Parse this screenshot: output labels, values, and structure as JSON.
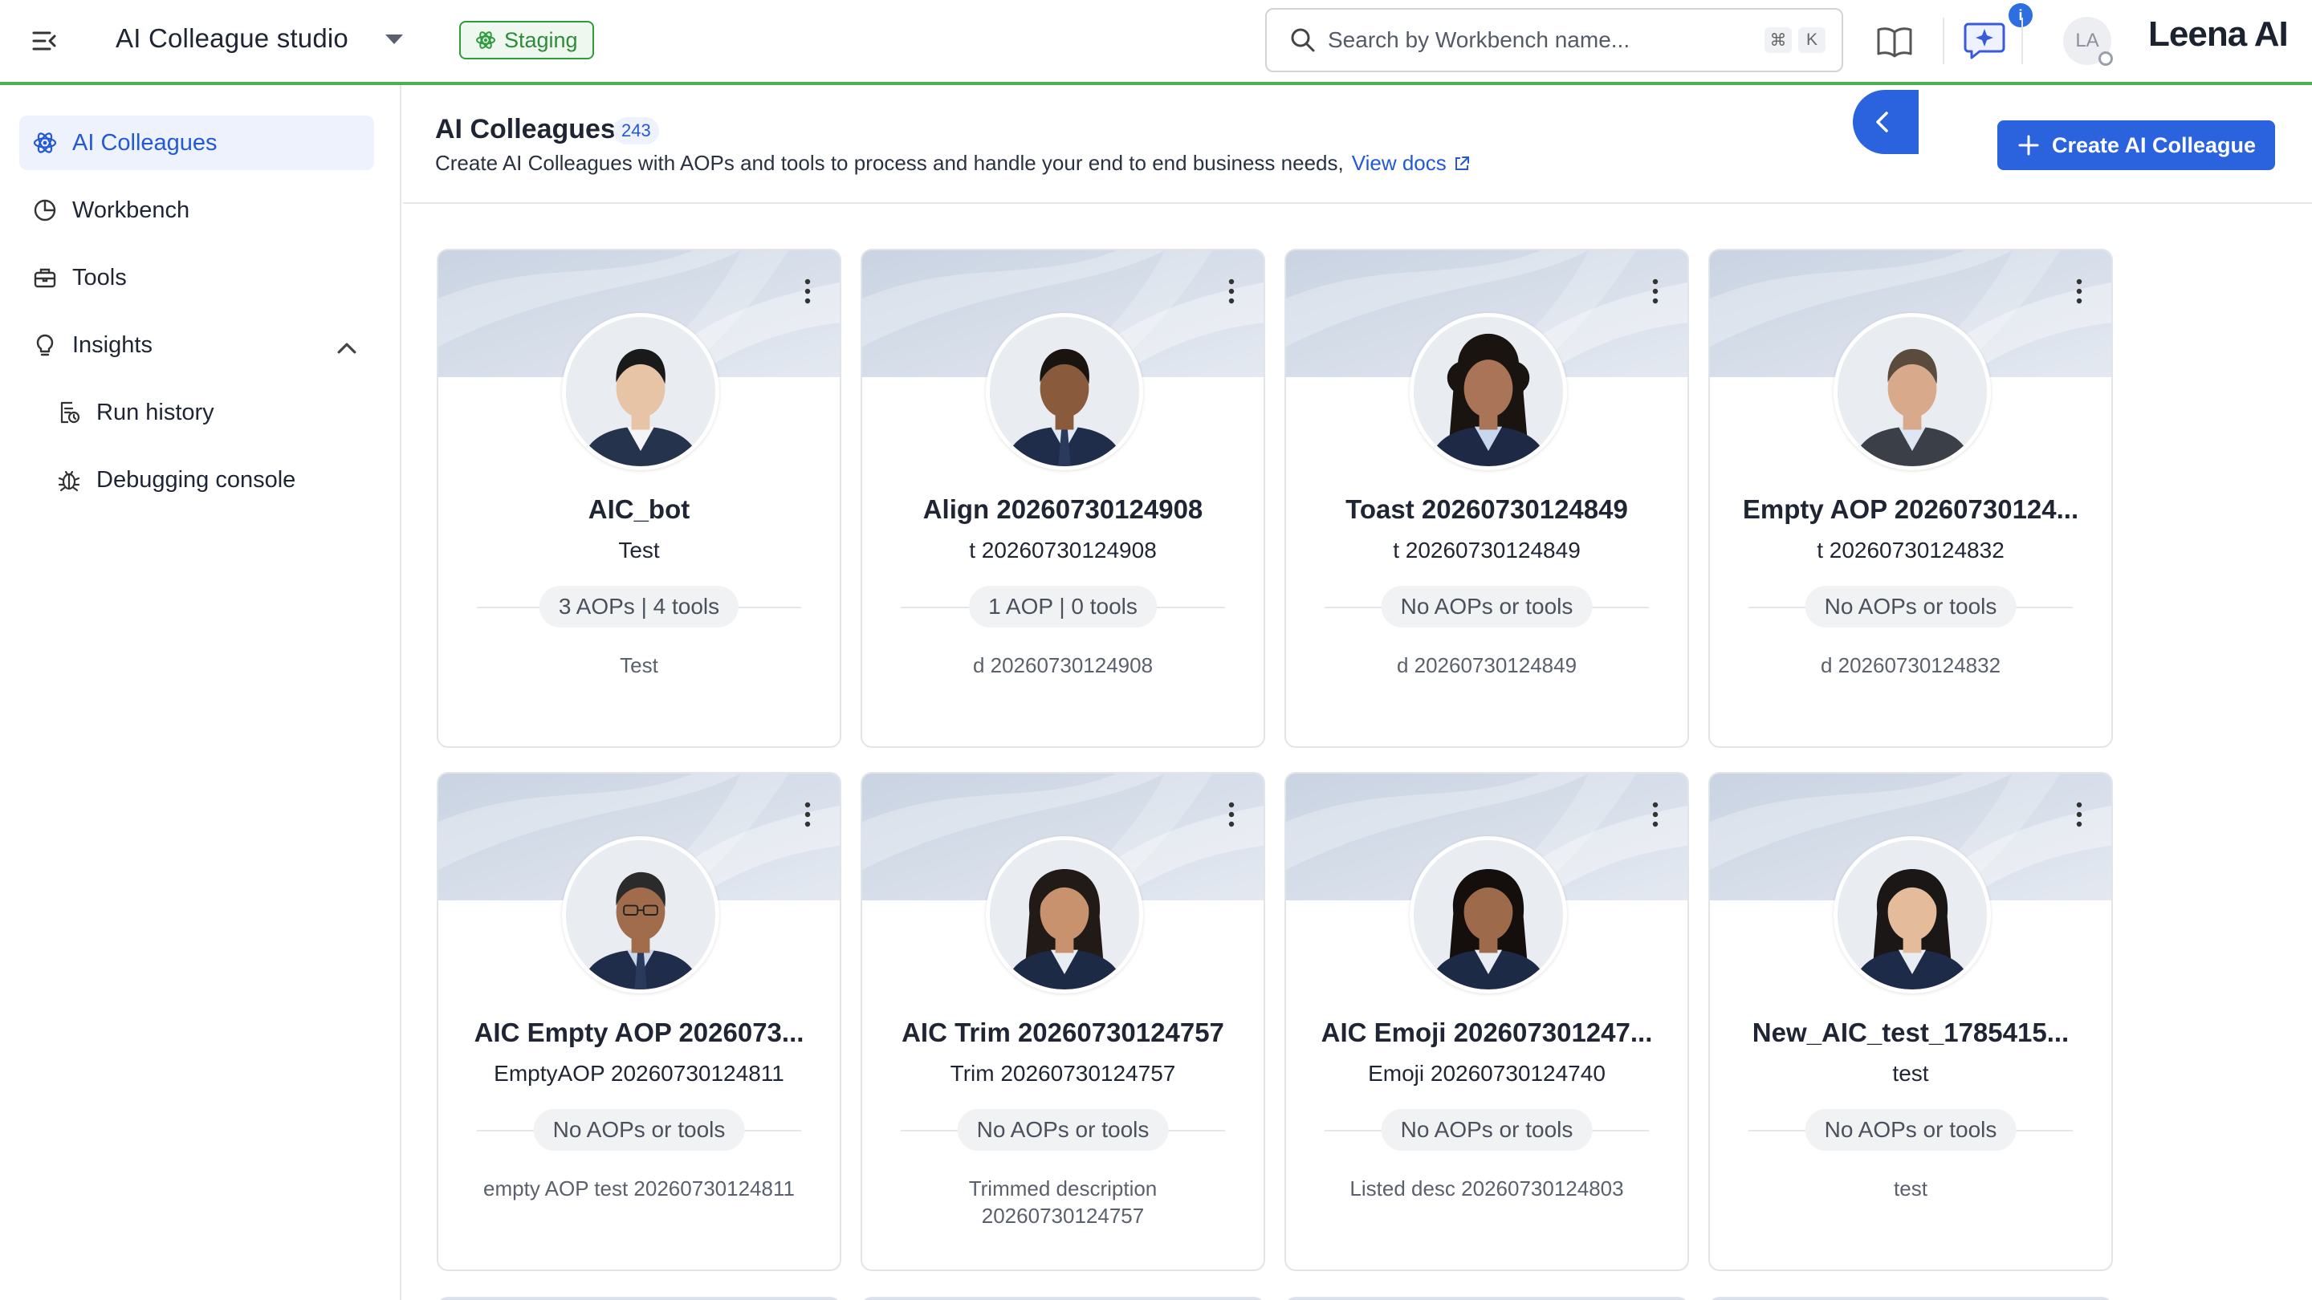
{
  "app": {
    "title": "AI Colleague studio",
    "environment": "Staging",
    "brand": "Leena AI"
  },
  "search": {
    "placeholder": "Search by Workbench name...",
    "shortcut": [
      "⌘",
      "K"
    ]
  },
  "notifications": {
    "badge": "i"
  },
  "user": {
    "initials": "LA"
  },
  "sidebar": {
    "items": [
      {
        "label": "AI Colleagues",
        "icon": "atom-icon",
        "active": true
      },
      {
        "label": "Workbench",
        "icon": "workbench-icon",
        "active": false
      },
      {
        "label": "Tools",
        "icon": "toolbox-icon",
        "active": false
      },
      {
        "label": "Insights",
        "icon": "lightbulb-icon",
        "active": false,
        "expanded": true
      },
      {
        "label": "Run history",
        "icon": "history-doc-icon",
        "active": false,
        "sub": true
      },
      {
        "label": "Debugging console",
        "icon": "bug-icon",
        "active": false,
        "sub": true
      }
    ]
  },
  "page": {
    "title": "AI Colleagues",
    "count": "243",
    "subtitle": "Create AI Colleagues with AOPs and tools to process and handle your end to end business needs,",
    "docs_link": "View docs",
    "create_button": "Create AI Colleague"
  },
  "colors": {
    "accent": "#2b62de",
    "staging_green": "#2e9b3f",
    "topbar_border": "#4caf50"
  },
  "cards": [
    {
      "name": "AIC_bot",
      "role": "Test",
      "summary": "3 AOPs | 4 tools",
      "description": "Test",
      "portrait": "woman-short-hair"
    },
    {
      "name": "Align 20260730124908",
      "role": "t 20260730124908",
      "summary": "1 AOP | 0 tools",
      "description": "d 20260730124908",
      "portrait": "man-dark-suit"
    },
    {
      "name": "Toast 20260730124849",
      "role": "t 20260730124849",
      "summary": "No AOPs or tools",
      "description": "d 20260730124849",
      "portrait": "woman-curly-hair"
    },
    {
      "name": "Empty AOP 20260730124...",
      "role": "t 20260730124832",
      "summary": "No AOPs or tools",
      "description": "d 20260730124832",
      "portrait": "man-gray-suit"
    },
    {
      "name": "AIC Empty AOP 2026073...",
      "role": "EmptyAOP 20260730124811",
      "summary": "No AOPs or tools",
      "description": "empty AOP test 20260730124811",
      "portrait": "man-glasses"
    },
    {
      "name": "AIC Trim 20260730124757",
      "role": "Trim 20260730124757",
      "summary": "No AOPs or tools",
      "description": "Trimmed description 20260730124757",
      "portrait": "woman-long-hair"
    },
    {
      "name": "AIC Emoji 202607301247...",
      "role": "Emoji 20260730124740",
      "summary": "No AOPs or tools",
      "description": "Listed desc 20260730124803",
      "portrait": "woman-dark-hair"
    },
    {
      "name": "New_AIC_test_1785415...",
      "role": "test",
      "summary": "No AOPs or tools",
      "description": "test",
      "portrait": "woman-bob-hair"
    }
  ]
}
